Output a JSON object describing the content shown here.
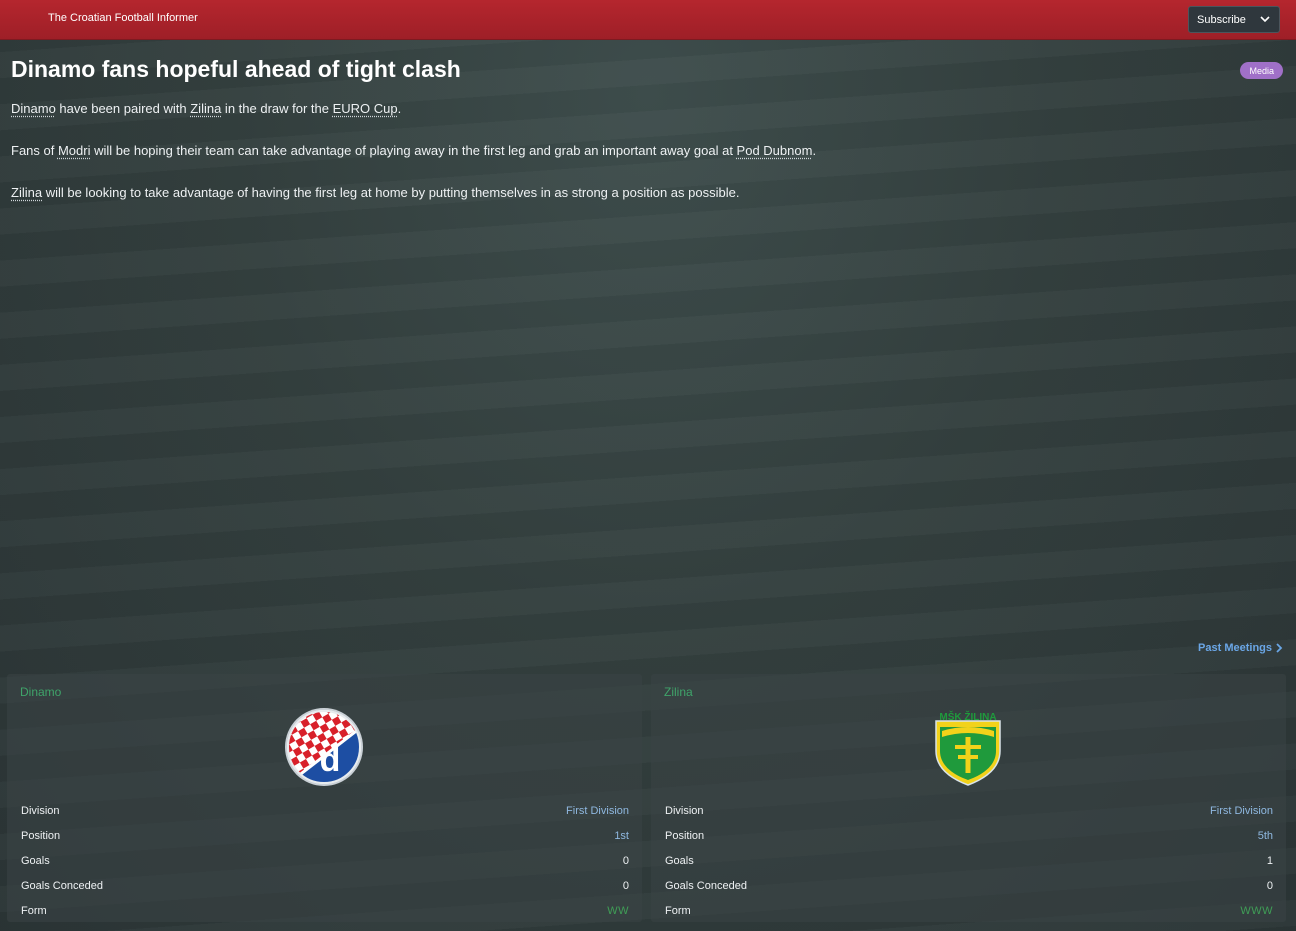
{
  "header": {
    "paper_name": "The Croatian Football Informer",
    "subscribe_label": "Subscribe"
  },
  "article": {
    "headline": "Dinamo fans hopeful ahead of tight clash",
    "badge": "Media",
    "para1": {
      "link1": "Dinamo",
      "text1": " have been paired with ",
      "link2": "Zilina",
      "text2": " in the draw for the ",
      "link3": "EURO Cup",
      "text3": "."
    },
    "para2": {
      "text1": "Fans of ",
      "link1": "Modri",
      "text2": " will be hoping their team can take advantage of playing away in the first leg and grab an important away goal at ",
      "link2": "Pod Dubnom",
      "text3": "."
    },
    "para3": {
      "link1": "Zilina",
      "text1": " will be looking to take advantage of having the first leg at home by putting themselves in as strong a position as possible."
    }
  },
  "past_meetings_label": "Past Meetings",
  "teams": [
    {
      "name": "Dinamo",
      "crest_icon": "dinamo-zagreb-crest",
      "stats": {
        "division_label": "Division",
        "division": "First Division",
        "position_label": "Position",
        "position": "1st",
        "goals_label": "Goals",
        "goals": "0",
        "conceded_label": "Goals Conceded",
        "conceded": "0",
        "form_label": "Form",
        "form": "WW"
      }
    },
    {
      "name": "Zilina",
      "crest_icon": "msk-zilina-crest",
      "crest_text": "MŠK ŽILINA",
      "stats": {
        "division_label": "Division",
        "division": "First Division",
        "position_label": "Position",
        "position": "5th",
        "goals_label": "Goals",
        "goals": "1",
        "conceded_label": "Goals Conceded",
        "conceded": "0",
        "form_label": "Form",
        "form": "WWW"
      }
    }
  ],
  "colors": {
    "header_red": "#b5262e",
    "team_green": "#3fa46a",
    "link_blue": "#6aa6e6",
    "badge_purple": "#a070c8",
    "form_green": "#3f9e56"
  }
}
